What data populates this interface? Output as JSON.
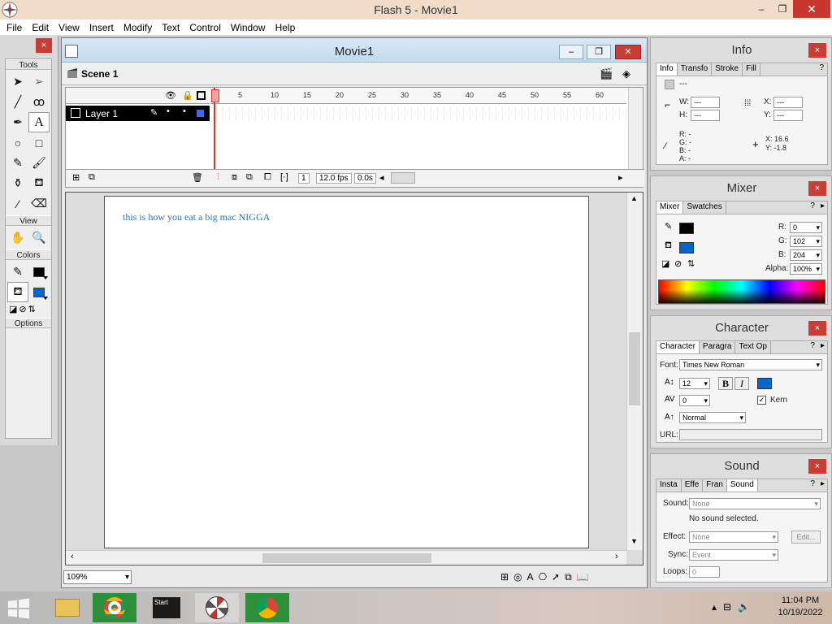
{
  "app": {
    "title": "Flash 5 - Movie1",
    "min_glyph": "–",
    "max_glyph": "❐",
    "close_glyph": "✕"
  },
  "menu": [
    "File",
    "Edit",
    "View",
    "Insert",
    "Modify",
    "Text",
    "Control",
    "Window",
    "Help"
  ],
  "tools": {
    "close_glyph": "×",
    "section_tools": "Tools",
    "section_view": "View",
    "section_colors": "Colors",
    "section_options": "Options",
    "stroke_color": "#000000",
    "fill_color": "#0066cc"
  },
  "movie": {
    "title": "Movie1",
    "scene": "Scene 1",
    "layer_name": "Layer 1",
    "ruler_ticks": [
      "5",
      "10",
      "15",
      "20",
      "25",
      "30",
      "35",
      "40",
      "45",
      "50",
      "55",
      "60"
    ],
    "current_frame": "1",
    "fps": "12.0 fps",
    "elapsed": "0.0s",
    "stage_text": "this is how you eat a big mac NIGGA",
    "zoom": "109%"
  },
  "info": {
    "title": "Info",
    "tabs": [
      "Info",
      "Transfo",
      "Stroke",
      "Fill"
    ],
    "dash": "---",
    "w_label": "W:",
    "h_label": "H:",
    "x_label": "X:",
    "y_label": "Y:",
    "w_value": "---",
    "h_value": "---",
    "x_value": "---",
    "y_value": "---",
    "r": "R: -",
    "g": "G: -",
    "b": "B: -",
    "a": "A: -",
    "cursor_x": "X:  16.6",
    "cursor_y": "Y:  -1.8"
  },
  "mixer": {
    "title": "Mixer",
    "tabs": [
      "Mixer",
      "Swatches"
    ],
    "r_label": "R:",
    "g_label": "G:",
    "b_label": "B:",
    "alpha_label": "Alpha:",
    "r_value": "0",
    "g_value": "102",
    "b_value": "204",
    "alpha_value": "100%",
    "stroke_color": "#000000",
    "fill_color": "#0066cc"
  },
  "character": {
    "title": "Character",
    "tabs": [
      "Character",
      "Paragra",
      "Text Op"
    ],
    "font_label": "Font:",
    "font_value": "Times New Roman",
    "size_value": "12",
    "bold": "B",
    "italic": "I",
    "tracking_value": "0",
    "kern_label": "Kern",
    "baseline_value": "Normal",
    "url_label": "URL:",
    "text_color": "#0066cc"
  },
  "sound": {
    "title": "Sound",
    "tabs": [
      "Insta",
      "Effe",
      "Fran",
      "Sound"
    ],
    "sound_label": "Sound:",
    "sound_value": "None",
    "no_sound": "No sound selected.",
    "effect_label": "Effect:",
    "effect_value": "None",
    "edit_button": "Edit...",
    "sync_label": "Sync:",
    "sync_value": "Event",
    "loops_label": "Loops:",
    "loops_value": "0"
  },
  "taskbar": {
    "start_label": "Start",
    "time": "11:04 PM",
    "date": "10/19/2022"
  }
}
